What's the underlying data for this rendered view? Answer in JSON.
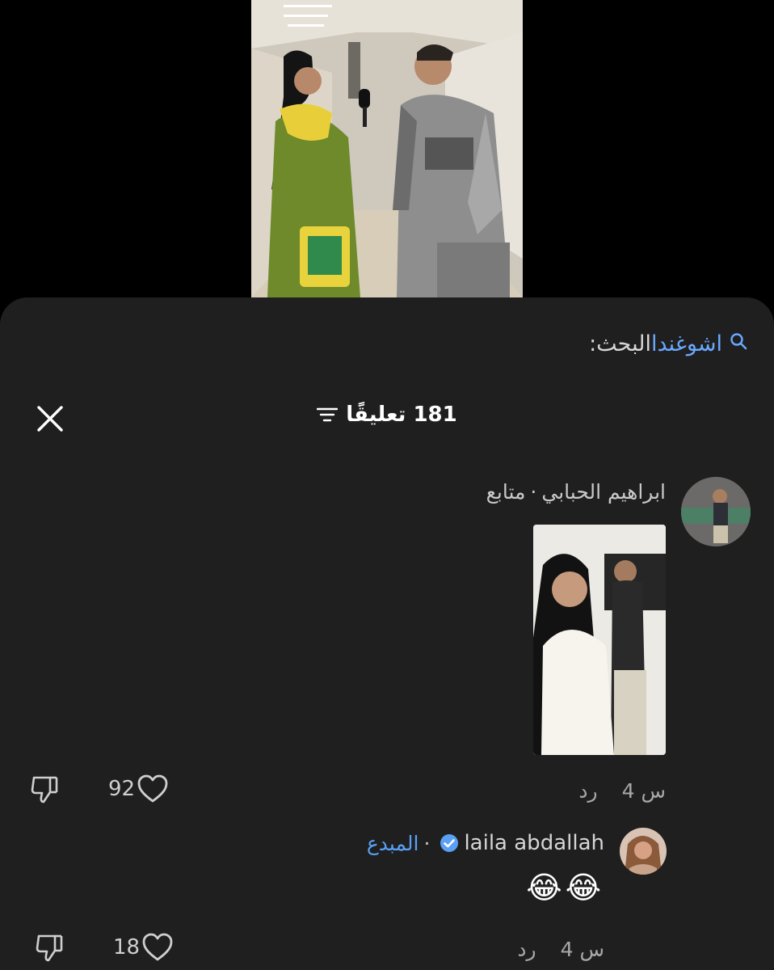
{
  "search": {
    "prefix": "البحث:",
    "term": "اشوغندا"
  },
  "header": {
    "count_label": "181 تعليقًا"
  },
  "comments": [
    {
      "username": "ابراهيم الحبابي",
      "status": "متابع",
      "time": "4 س",
      "reply_label": "رد",
      "likes": "92",
      "has_image": true
    },
    {
      "username": "laila abdallah",
      "status": "المبدع",
      "verified": true,
      "text": "😂😂",
      "time": "4 س",
      "reply_label": "رد",
      "likes": "18"
    }
  ],
  "colors": {
    "accent": "#5aa0f5",
    "sheet": "#1f1f1f",
    "background": "#000000"
  }
}
